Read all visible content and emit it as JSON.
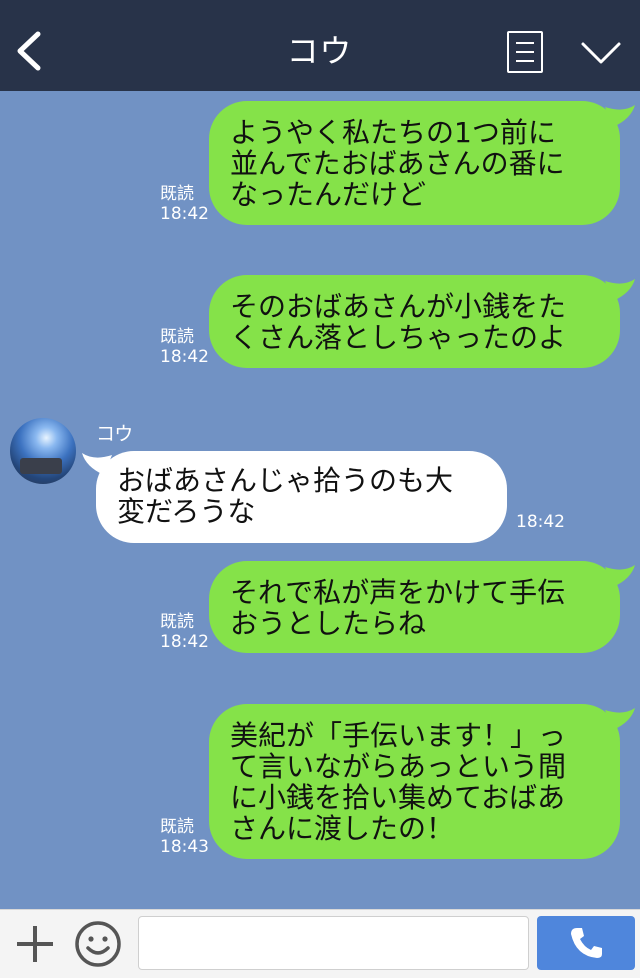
{
  "header": {
    "title": "コウ"
  },
  "messages": [
    {
      "from": "me",
      "lines": [
        "ようやく私たちの1つ前に",
        "並んでたおばあさんの番に",
        "なったんだけど"
      ],
      "read": "既読",
      "time": "18:42"
    },
    {
      "from": "me",
      "lines": [
        "そのおばあさんが小銭をた",
        "くさん落としちゃったのよ"
      ],
      "read": "既読",
      "time": "18:42"
    },
    {
      "from": "them",
      "sender": "コウ",
      "lines": [
        "おばあさんじゃ拾うのも大",
        "変だろうな"
      ],
      "time": "18:42"
    },
    {
      "from": "me",
      "lines": [
        "それで私が声をかけて手伝",
        "おうとしたらね"
      ],
      "read": "既読",
      "time": "18:42"
    },
    {
      "from": "me",
      "lines": [
        "美紀が「手伝います！」っ",
        "て言いながらあっという間",
        "に小銭を拾い集めておばあ",
        "さんに渡したの！"
      ],
      "read": "既読",
      "time": "18:43"
    }
  ],
  "footer": {
    "input_value": "",
    "icons": [
      "plus-icon",
      "emoji-icon",
      "phone-icon"
    ]
  },
  "colors": {
    "header_bg": "#283349",
    "chat_bg": "#7192c4",
    "my_bubble": "#85e249",
    "their_bubble": "#ffffff",
    "call_button": "#4f86dc"
  }
}
